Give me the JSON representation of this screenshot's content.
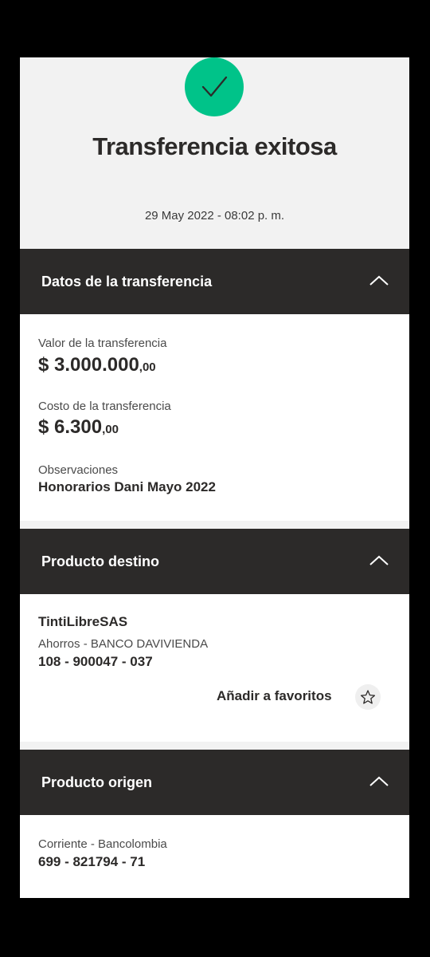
{
  "hero": {
    "title": "Transferencia exitosa",
    "date": "29 May 2022 - 08:02 p. m.",
    "icon": "check-icon",
    "accent_color": "#00c389"
  },
  "datos": {
    "header": "Datos de la transferencia",
    "valor_label": "Valor de la transferencia",
    "valor_amount": "$ 3.000.000",
    "valor_cents": ",00",
    "costo_label": "Costo de la transferencia",
    "costo_amount": "$ 6.300",
    "costo_cents": ",00",
    "observaciones_label": "Observaciones",
    "observaciones_value": "Honorarios Dani Mayo 2022"
  },
  "destino": {
    "header": "Producto destino",
    "name": "TintiLibreSAS",
    "account_type": "Ahorros - BANCO DAVIVIENDA",
    "account_number": "108 - 900047 - 037",
    "favorites_label": "Añadir a favoritos",
    "favorites_icon": "star-icon"
  },
  "origen": {
    "header": "Producto origen",
    "account_type": "Corriente - Bancolombia",
    "account_number": "699 - 821794 - 71"
  },
  "colors": {
    "header_bg": "#2c2a29",
    "hero_bg": "#f2f2f2",
    "success": "#00c389"
  }
}
